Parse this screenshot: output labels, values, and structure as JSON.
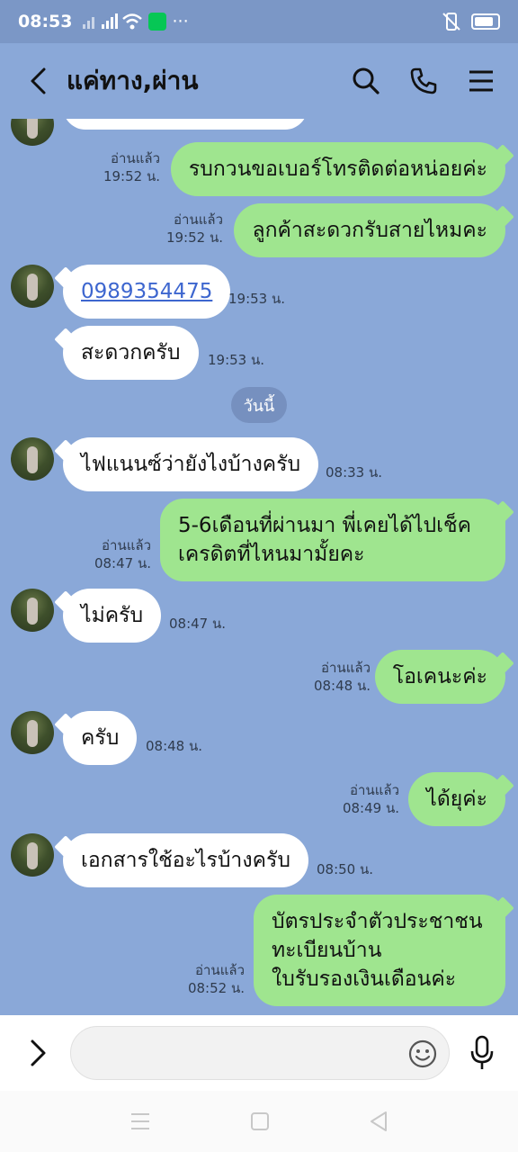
{
  "status_bar": {
    "time": "08:53",
    "icons": [
      "signal-off-icon",
      "signal-icon",
      "wifi-icon",
      "line-app-icon",
      "more-icon",
      "vibrate-icon",
      "battery-icon"
    ]
  },
  "header": {
    "title": "แค่ทาง,ผ่าน",
    "icons": [
      "back-icon",
      "search-icon",
      "phone-icon",
      "menu-icon"
    ]
  },
  "messages": [
    {
      "dir": "out",
      "text": "รบกวนขอเบอร์โทรติดต่อหน่อยค่ะ",
      "read": "อ่านแล้ว",
      "time": "19:52 น."
    },
    {
      "dir": "out",
      "text": "ลูกค้าสะดวกรับสายไหมคะ",
      "read": "อ่านแล้ว",
      "time": "19:52 น."
    },
    {
      "dir": "in",
      "text": "0989354475",
      "time": "19:53 น."
    },
    {
      "dir": "in",
      "text": "สะดวกครับ",
      "time": "19:53 น."
    },
    {
      "dir": "in",
      "text": "ไฟแนนซ์ว่ายังไงบ้างครับ",
      "time": "08:33 น."
    },
    {
      "dir": "out",
      "text": "5-6เดือนที่ผ่านมา พี่เคยได้ไปเช็คเครดิตที่ไหนมามั้ยคะ",
      "read": "อ่านแล้ว",
      "time": "08:47 น."
    },
    {
      "dir": "in",
      "text": "ไม่ครับ",
      "time": "08:47 น."
    },
    {
      "dir": "out",
      "text": "โอเคนะค่ะ",
      "read": "อ่านแล้ว",
      "time": "08:48 น."
    },
    {
      "dir": "in",
      "text": "ครับ",
      "time": "08:48 น."
    },
    {
      "dir": "out",
      "text": "ได้ยุค่ะ",
      "read": "อ่านแล้ว",
      "time": "08:49 น."
    },
    {
      "dir": "in",
      "text": "เอกสารใช้อะไรบ้างครับ",
      "time": "08:50 น."
    },
    {
      "dir": "out",
      "text": "บัตรประจำตัวประชาชน ทะเบียนบ้าน ใบรับรองเงินเดือนค่ะ",
      "read": "อ่านแล้ว",
      "time": "08:52 น."
    }
  ],
  "msg_lines": {
    "m6": [
      "5-6เดือนที่ผ่านมา พี่เคยได้ไปเช็ค",
      "เครดิตที่ไหนมามั้ยคะ"
    ],
    "m12": [
      "บัตรประจำตัวประชาชน",
      "ทะเบียนบ้าน",
      "ใบรับรองเงินเดือนค่ะ"
    ]
  },
  "day_separator": "วันนี้",
  "input": {
    "value": "",
    "placeholder": ""
  },
  "colors": {
    "chat_bg": "#8aa8d8",
    "outgoing_bubble": "#9fe58f",
    "incoming_bubble": "#ffffff",
    "link": "#3d66cf"
  }
}
